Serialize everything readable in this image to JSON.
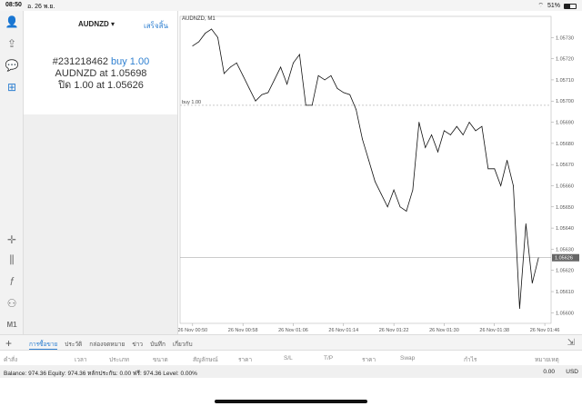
{
  "status": {
    "time": "08:50",
    "date": "อ. 26 พ.ย.",
    "battery": "51%",
    "battery_level": 0.51
  },
  "toolbar_icons": [
    "account-icon",
    "signal-icon",
    "chat-icon",
    "new-order-icon"
  ],
  "toolbar_bottom_icons": [
    "crosshair-icon",
    "candles-icon",
    "function-icon",
    "objects-icon"
  ],
  "toolbar_timeframe": "M1",
  "order_panel": {
    "symbol": "AUDNZD",
    "done_label": "เสร็จสิ้น",
    "ticket": "#231218462",
    "action": "buy 1.00",
    "open_line": "AUDNZD at 1.05698",
    "close_line": "ปิด 1.00 at 1.05626"
  },
  "chart_data": {
    "type": "line",
    "title": "AUDNZD, M1",
    "ylim": [
      1.05595,
      1.0574
    ],
    "yticks": [
      "1.05730",
      "1.05720",
      "1.05710",
      "1.05700",
      "1.05690",
      "1.05680",
      "1.05670",
      "1.05660",
      "1.05650",
      "1.05640",
      "1.05630",
      "1.05620",
      "1.05610",
      "1.05600"
    ],
    "xticks": [
      "26 Nov 00:50",
      "26 Nov 00:58",
      "26 Nov 01:06",
      "26 Nov 01:14",
      "26 Nov 01:22",
      "26 Nov 01:30",
      "26 Nov 01:38",
      "26 Nov 01:46"
    ],
    "x_ticks_minutes": [
      50,
      58,
      66,
      74,
      82,
      90,
      98,
      106
    ],
    "x_minutes": [
      50,
      51,
      52,
      53,
      54,
      55,
      56,
      57,
      58,
      59,
      60,
      61,
      62,
      63,
      64,
      65,
      66,
      67,
      68,
      69,
      70,
      71,
      72,
      73,
      74,
      75,
      76,
      77,
      78,
      79,
      80,
      81,
      82,
      83,
      84,
      85,
      86,
      87,
      88,
      89,
      90,
      91,
      92,
      93,
      94,
      95,
      96,
      97,
      98,
      99,
      100,
      101,
      102,
      103,
      104,
      105
    ],
    "values": [
      1.05726,
      1.05728,
      1.05732,
      1.05734,
      1.0573,
      1.05713,
      1.05716,
      1.05718,
      1.05712,
      1.05706,
      1.057,
      1.05703,
      1.05704,
      1.0571,
      1.05716,
      1.05708,
      1.05718,
      1.05722,
      1.05698,
      1.05698,
      1.05712,
      1.0571,
      1.05712,
      1.05706,
      1.05704,
      1.05703,
      1.05696,
      1.05682,
      1.05672,
      1.05662,
      1.05656,
      1.0565,
      1.05658,
      1.0565,
      1.05648,
      1.05658,
      1.0569,
      1.05678,
      1.05684,
      1.05676,
      1.05686,
      1.05684,
      1.05688,
      1.05684,
      1.0569,
      1.05686,
      1.05688,
      1.05668,
      1.05668,
      1.0566,
      1.05672,
      1.0566,
      1.05602,
      1.05642,
      1.05614,
      1.05626
    ],
    "reference_lines": [
      {
        "label": "buy 1.00",
        "value": 1.05698,
        "style": "dashed"
      },
      {
        "label": "1.05626",
        "value": 1.05626,
        "style": "solid"
      }
    ],
    "grid": false
  },
  "tabs": {
    "items": [
      "การซื้อขาย",
      "ประวัติ",
      "กล่องจดหมาย",
      "ข่าว",
      "บันทึก",
      "เกี่ยวกับ"
    ],
    "active": 0
  },
  "table_headers": [
    "คำสั่ง",
    "เวลา",
    "ประเภท",
    "ขนาด",
    "สัญลักษณ์",
    "ราคา",
    "S/L",
    "T/P",
    "ราคา",
    "Swap",
    "กำไร",
    "หมายเหตุ"
  ],
  "balance": {
    "text": "Balance: 974.36 Equity: 974.36 หลักประกัน: 0.00 ฟรี: 974.36 Level: 0.00%",
    "total": "0.00",
    "currency": "USD"
  },
  "colors": {
    "accent": "#2f80d1",
    "line": "#111111",
    "grid": "#e6e6e6"
  }
}
